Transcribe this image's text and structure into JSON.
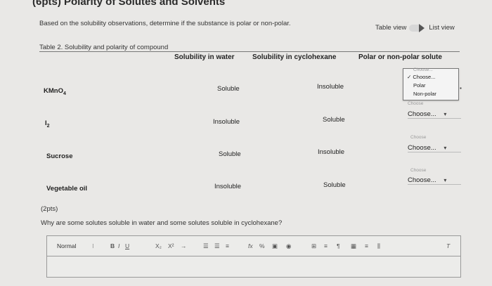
{
  "section_title": "(6pts) Polarity of Solutes and Solvents",
  "instruction": "Based on the solubility observations, determine if the substance is polar or non-polar.",
  "view_toggle": {
    "table_view": "Table view",
    "list_view": "List view"
  },
  "table": {
    "caption": "Table 2. Solubility and polarity of compound",
    "headers": [
      "Solubility in water",
      "Solubility in cyclohexane",
      "Polar or non-polar solute"
    ],
    "rows": [
      {
        "compound": "KMnO",
        "compound_sub": "4",
        "water": "Soluble",
        "cyclohexane": "Insoluble"
      },
      {
        "compound": "I",
        "compound_sub": "2",
        "water": "Insoluble",
        "cyclohexane": "Soluble"
      },
      {
        "compound": "Sucrose",
        "compound_sub": "",
        "water": "Soluble",
        "cyclohexane": "Insoluble"
      },
      {
        "compound": "Vegetable oil",
        "compound_sub": "",
        "water": "Insoluble",
        "cyclohexane": "Soluble"
      }
    ],
    "dropdown_open": {
      "header": "Choose...",
      "options": [
        "✓ Choose...",
        "Polar",
        "Non-polar"
      ]
    },
    "choose_label": "Choose...",
    "choose_small": "Choose"
  },
  "question": {
    "points": "(2pts)",
    "text": "Why are some solutes soluble in water and some solutes soluble in cyclohexane?"
  },
  "editor": {
    "format": "Normal",
    "toolbar_icons": [
      "B",
      "I",
      "U",
      "X₂",
      "X²",
      "→",
      "list-ordered",
      "list-bullet",
      "align",
      "fx",
      "link",
      "image",
      "media",
      "table",
      "more",
      "clear-format"
    ],
    "text": ""
  }
}
